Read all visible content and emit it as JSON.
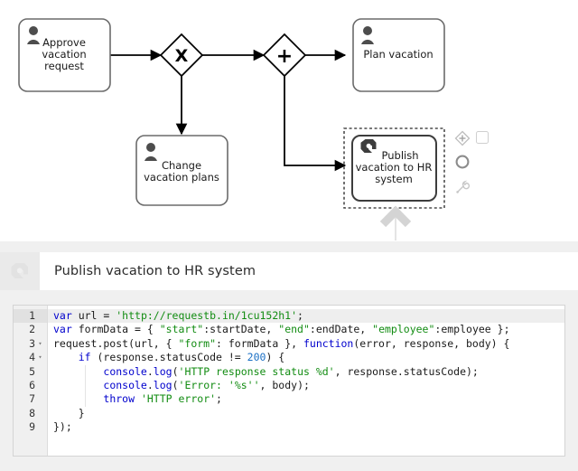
{
  "diagram": {
    "name": "bpmn-process-diagram",
    "tasks": [
      {
        "id": "approve",
        "label": "Approve vacation request",
        "type": "user-task",
        "icon": "user-icon"
      },
      {
        "id": "change",
        "label": "Change vacation plans",
        "type": "user-task",
        "icon": "user-icon"
      },
      {
        "id": "plan",
        "label": "Plan vacation",
        "type": "user-task",
        "icon": "user-icon"
      },
      {
        "id": "publish",
        "label": "Publish vacation to HR system",
        "type": "service-task",
        "icon": "service-task-icon",
        "selected": true
      }
    ],
    "gateways": [
      {
        "id": "xor",
        "glyph": "X",
        "type": "exclusive-gateway"
      },
      {
        "id": "par",
        "glyph": "+",
        "type": "parallel-gateway"
      }
    ],
    "colors": {
      "shape_stroke": "#6b6b6b",
      "shape_fill": "#ffffff",
      "connection": "#000000",
      "task_icon": "#4d4d4d",
      "selection_outline": "#555555"
    }
  },
  "context_pad": {
    "entries": [
      {
        "name": "append-gateway-icon",
        "title": "Append gateway"
      },
      {
        "name": "append-end-event-icon",
        "title": "Append end event"
      },
      {
        "name": "append-task-wrench-icon",
        "title": "Append task"
      },
      {
        "name": "selection-checkbox",
        "title": "Selection"
      }
    ]
  },
  "panel": {
    "icon": "service-task-icon",
    "title": "Publish vacation to HR system"
  },
  "editor": {
    "name": "javascript-code-editor",
    "language": "javascript",
    "active_line": 1,
    "line_numbers": [
      "1",
      "2",
      "3",
      "4",
      "5",
      "6",
      "7",
      "8",
      "9"
    ],
    "folds": {
      "3": true,
      "4": true
    },
    "lines": [
      "var url = 'http://requestb.in/1cu152h1';",
      "var formData = { \"start\":startDate, \"end\":endDate, \"employee\":employee };",
      "request.post(url, { \"form\": formData }, function(error, response, body) {",
      "    if (response.statusCode != 200) {",
      "        console.log('HTTP response status %d', response.statusCode);",
      "        console.log('Error: '%s'', body);",
      "        throw 'HTTP error';",
      "    }",
      "});"
    ],
    "colors": {
      "keyword": "#0000cd",
      "string": "#128c12",
      "number": "#1a6fc4",
      "text": "#1a1a1a",
      "gutter_bg": "#f0f0f0",
      "active_line_bg": "#eeeeee"
    }
  }
}
